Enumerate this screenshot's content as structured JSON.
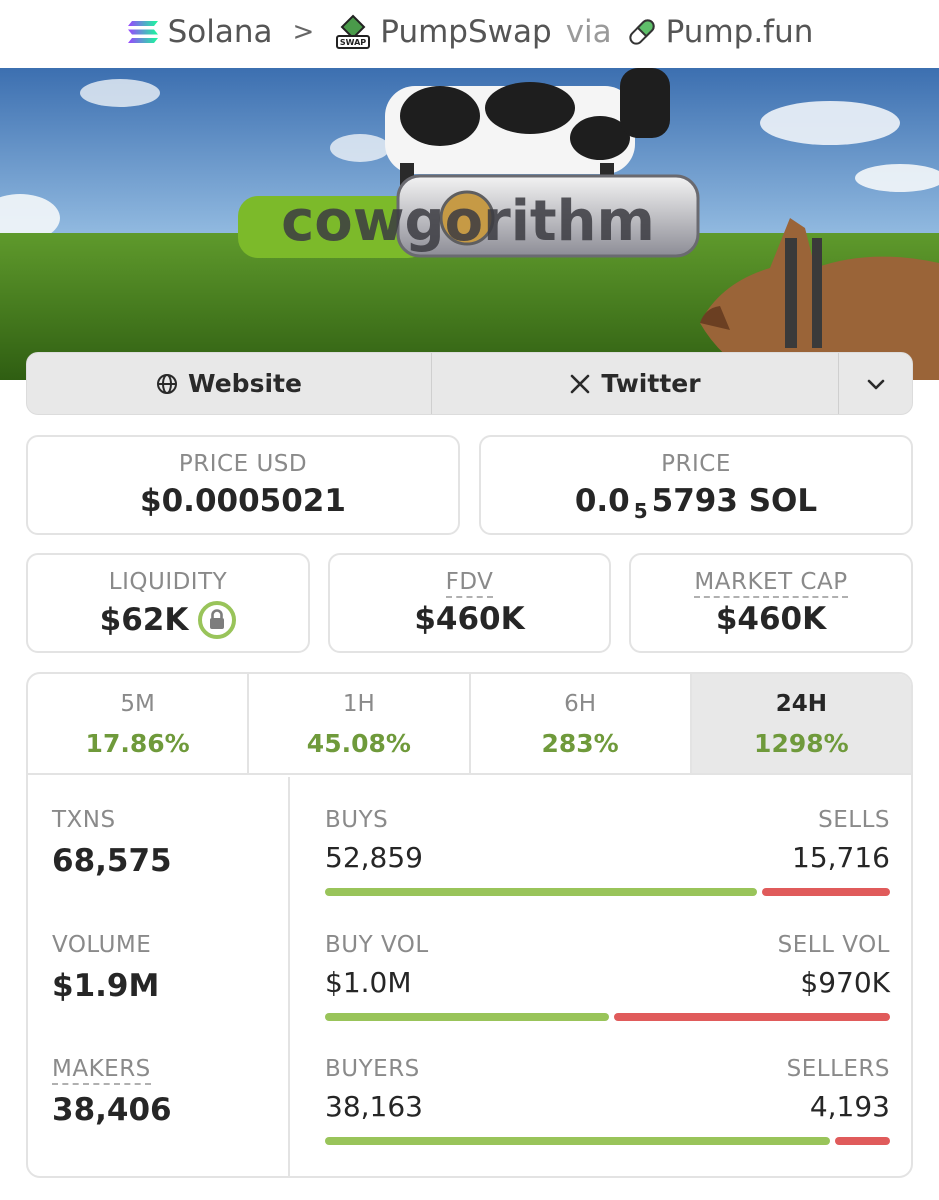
{
  "breadcrumb": {
    "chain": "Solana",
    "separator": ">",
    "dex": "PumpSwap",
    "dex_icon_text": "SWAP",
    "via": "via",
    "launchpad": "Pump.fun"
  },
  "banner": {
    "logo_text": "cowgorithm"
  },
  "links": {
    "website": "Website",
    "twitter": "Twitter"
  },
  "stats": {
    "price_usd_label": "PRICE USD",
    "price_usd_value": "$0.0005021",
    "price_label": "PRICE",
    "price_value_prefix": "0.0",
    "price_value_sub": "5",
    "price_value_suffix": "5793 SOL",
    "liquidity_label": "LIQUIDITY",
    "liquidity_value": "$62K",
    "fdv_label": "FDV",
    "fdv_value": "$460K",
    "mcap_label": "MARKET CAP",
    "mcap_value": "$460K"
  },
  "timeframes": [
    {
      "label": "5M",
      "change": "17.86%",
      "active": false
    },
    {
      "label": "1H",
      "change": "45.08%",
      "active": false
    },
    {
      "label": "6H",
      "change": "283%",
      "active": false
    },
    {
      "label": "24H",
      "change": "1298%",
      "active": true
    }
  ],
  "summary": {
    "txns_label": "TXNS",
    "txns_value": "68,575",
    "volume_label": "VOLUME",
    "volume_value": "$1.9M",
    "makers_label": "MAKERS",
    "makers_value": "38,406"
  },
  "breakdown": {
    "buys_label": "BUYS",
    "buys_value": "52,859",
    "sells_label": "SELLS",
    "sells_value": "15,716",
    "buys_fraction": 0.771,
    "buy_vol_label": "BUY VOL",
    "buy_vol_value": "$1.0M",
    "sell_vol_label": "SELL VOL",
    "sell_vol_value": "$970K",
    "buy_vol_fraction": 0.508,
    "buyers_label": "BUYERS",
    "buyers_value": "38,163",
    "sellers_label": "SELLERS",
    "sellers_value": "4,193",
    "buyers_fraction": 0.901
  },
  "colors": {
    "positive": "#6f9a3b",
    "buy_bar": "#99c45a",
    "sell_bar": "#e05b5b"
  }
}
